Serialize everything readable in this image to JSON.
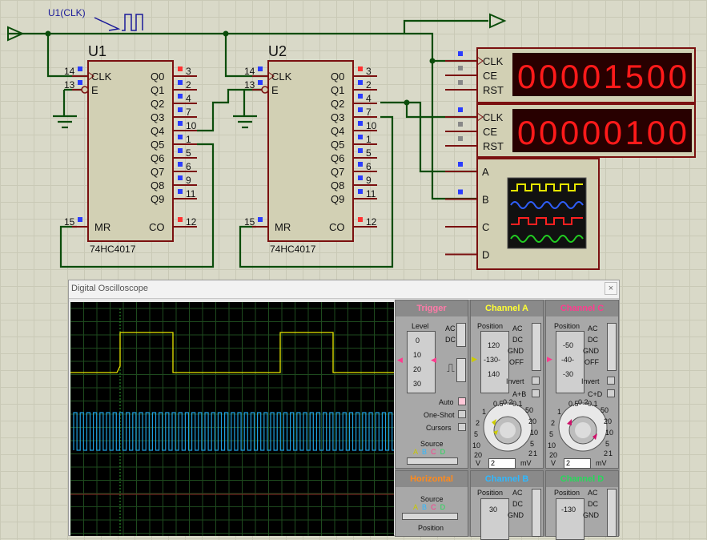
{
  "schematic": {
    "clock_label": "U1(CLK)",
    "u1": {
      "ref": "U1",
      "part": "74HC4017",
      "left_pins": [
        {
          "num": "14",
          "name": "CLK"
        },
        {
          "num": "13",
          "name": "E"
        }
      ],
      "mr": {
        "num": "15",
        "name": "MR"
      },
      "right_pins": [
        {
          "name": "Q0",
          "num": "3"
        },
        {
          "name": "Q1",
          "num": "2"
        },
        {
          "name": "Q2",
          "num": "4"
        },
        {
          "name": "Q3",
          "num": "7"
        },
        {
          "name": "Q4",
          "num": "10"
        },
        {
          "name": "Q5",
          "num": "1"
        },
        {
          "name": "Q6",
          "num": "5"
        },
        {
          "name": "Q7",
          "num": "6"
        },
        {
          "name": "Q8",
          "num": "9"
        },
        {
          "name": "Q9",
          "num": "11"
        }
      ],
      "co": {
        "name": "CO",
        "num": "12"
      }
    },
    "u2": {
      "ref": "U2",
      "part": "74HC4017",
      "left_pins": [
        {
          "num": "14",
          "name": "CLK"
        },
        {
          "num": "13",
          "name": "E"
        }
      ],
      "mr": {
        "num": "15",
        "name": "MR"
      },
      "right_pins": [
        {
          "name": "Q0",
          "num": "3"
        },
        {
          "name": "Q1",
          "num": "2"
        },
        {
          "name": "Q2",
          "num": "4"
        },
        {
          "name": "Q3",
          "num": "7"
        },
        {
          "name": "Q4",
          "num": "10"
        },
        {
          "name": "Q5",
          "num": "1"
        },
        {
          "name": "Q6",
          "num": "5"
        },
        {
          "name": "Q7",
          "num": "6"
        },
        {
          "name": "Q8",
          "num": "9"
        },
        {
          "name": "Q9",
          "num": "11"
        }
      ],
      "co": {
        "name": "CO",
        "num": "12"
      }
    },
    "counter1": {
      "pins": [
        "CLK",
        "CE",
        "RST"
      ],
      "digits": "00001500"
    },
    "counter2": {
      "pins": [
        "CLK",
        "CE",
        "RST"
      ],
      "digits": "00000100"
    },
    "scope_pins": [
      "A",
      "B",
      "C",
      "D"
    ],
    "colors": {
      "wire": "#0b4d0b",
      "chip_fill": "#d2d0b4",
      "chip_border": "#7a1010",
      "led_red": "#ff1a1a",
      "led_bg": "#280000"
    }
  },
  "oscilloscope": {
    "title": "Digital Oscilloscope",
    "close": "×",
    "trigger": {
      "title": "Trigger",
      "level_label": "Level",
      "ac": "AC",
      "dc": "DC",
      "auto": "Auto",
      "one_shot": "One-Shot",
      "cursors": "Cursors",
      "source": "Source",
      "source_letters": [
        "A",
        "B",
        "C",
        "D"
      ],
      "scale": [
        "0",
        "10",
        "20",
        "30"
      ]
    },
    "channel_a": {
      "title": "Channel A",
      "position": "Position",
      "scale": [
        "120",
        "-130-",
        "140"
      ],
      "ac": "AC",
      "dc": "DC",
      "gnd": "GND",
      "off": "OFF",
      "invert": "Invert",
      "aplusb": "A+B",
      "volts": "2",
      "v": "V",
      "mv": "mV",
      "dial": [
        "0.5",
        "0.2",
        "0.1",
        "50",
        "1",
        "20",
        "2",
        "10",
        "5",
        "5",
        "10",
        "2",
        "20",
        "1"
      ]
    },
    "channel_c": {
      "title": "Channel C",
      "position": "Position",
      "scale": [
        "-50",
        "-40-",
        "-30"
      ],
      "ac": "AC",
      "dc": "DC",
      "gnd": "GND",
      "off": "OFF",
      "invert": "Invert",
      "cplusd": "C+D",
      "volts": "2",
      "v": "V",
      "mv": "mV",
      "dial": [
        "0.5",
        "0.2",
        "0.1",
        "50",
        "1",
        "20",
        "2",
        "10",
        "5",
        "5",
        "10",
        "2",
        "20",
        "1"
      ]
    },
    "horizontal": {
      "title": "Horizontal",
      "source": "Source",
      "source_letters": [
        "A",
        "B",
        "C",
        "D"
      ],
      "position": "Position"
    },
    "channel_b": {
      "title": "Channel B",
      "position": "Position",
      "scale_top": "30",
      "ac": "AC",
      "dc": "DC",
      "gnd": "GND"
    },
    "channel_d": {
      "title": "Channel D",
      "position": "Position",
      "scale_top": "-130",
      "ac": "AC",
      "dc": "DC",
      "gnd": "GND"
    },
    "colors": {
      "trigger": "#ff7aa8",
      "channel_a": "#ffff33",
      "channel_c": "#ff3b8e",
      "horizontal": "#ff8a1c",
      "channel_b": "#2fb8ff",
      "channel_d": "#27d95b",
      "trace_a": "#e6e600",
      "trace_b": "#1f9fe0"
    }
  }
}
